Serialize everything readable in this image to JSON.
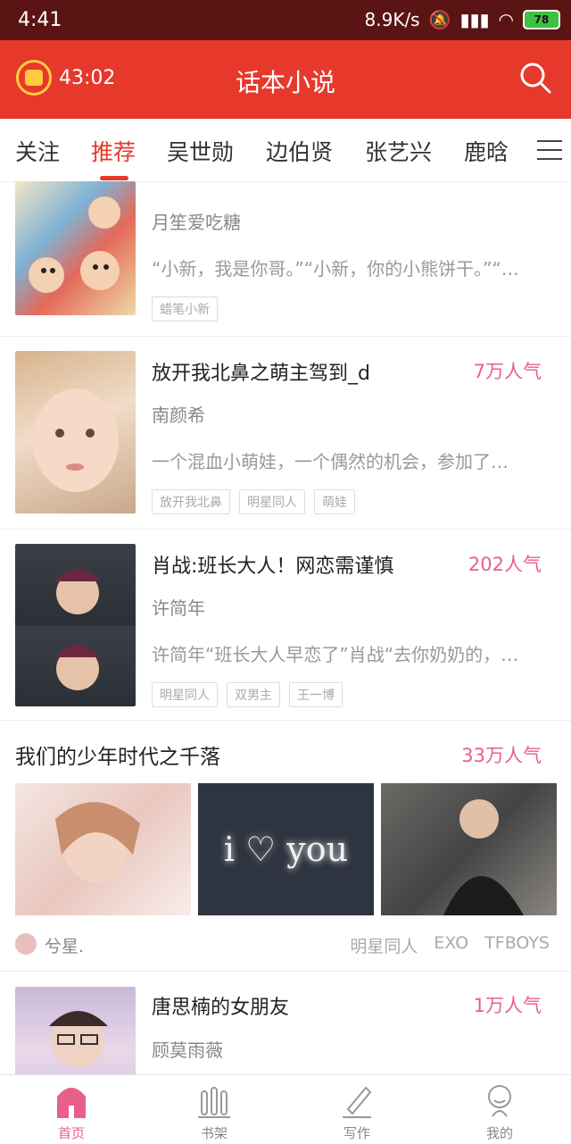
{
  "status": {
    "time": "4:41",
    "net": "8.9K/s",
    "battery": "78"
  },
  "appbar": {
    "timer": "43:02",
    "title": "话本小说",
    "colors": {
      "bar": "#e7382c",
      "accent": "#e95f8a"
    }
  },
  "tabs": [
    {
      "label": "关注"
    },
    {
      "label": "推荐"
    },
    {
      "label": "吴世勋"
    },
    {
      "label": "边伯贤"
    },
    {
      "label": "张艺兴"
    },
    {
      "label": "鹿晗"
    }
  ],
  "stories": [
    {
      "author": "月笙爱吃糖",
      "desc": "“小新，我是你哥。”“小新，你的小熊饼干。”“…",
      "tags": [
        "蜡笔小新"
      ]
    },
    {
      "title": "放开我北鼻之萌主驾到_d",
      "pop": "7万人气",
      "author": "南颜希",
      "desc": "一个混血小萌娃，一个偶然的机会，参加了…",
      "tags": [
        "放开我北鼻",
        "明星同人",
        "萌娃"
      ]
    },
    {
      "title": "肖战:班长大人！网恋需谨慎",
      "pop": "202人气",
      "author": "许简年",
      "desc": "许简年“班长大人早恋了”肖战“去你奶奶的，…",
      "tags": [
        "明星同人",
        "双男主",
        "王一博"
      ]
    }
  ],
  "featured": {
    "title": "我们的少年时代之千落",
    "pop": "33万人气",
    "photo_text": "i ♡ you",
    "author": "兮星.",
    "tags": [
      "明星同人",
      "EXO",
      "TFBOYS"
    ]
  },
  "last_story": {
    "title": "唐思楠的女朋友",
    "pop": "1万人气",
    "author": "顾莫雨薇"
  },
  "bottom_nav": [
    {
      "label": "首页",
      "icon": "home-icon"
    },
    {
      "label": "书架",
      "icon": "bookshelf-icon"
    },
    {
      "label": "写作",
      "icon": "pen-icon"
    },
    {
      "label": "我的",
      "icon": "profile-icon"
    }
  ]
}
